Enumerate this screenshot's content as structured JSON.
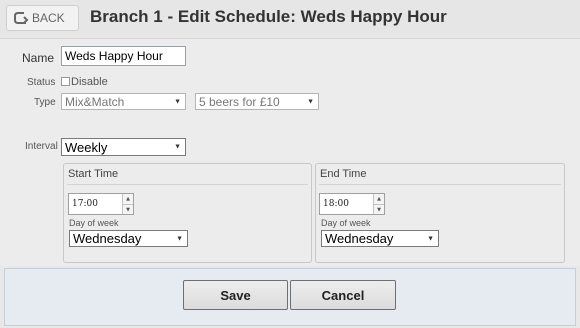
{
  "header": {
    "back_label": "BACK",
    "title": "Branch 1 - Edit Schedule: Weds Happy Hour"
  },
  "form": {
    "name_label": "Name",
    "name_value": "Weds Happy Hour",
    "status_label": "Status",
    "disable_label": "Disable",
    "disable_checked": false,
    "type_label": "Type",
    "type_value": "Mix&Match",
    "promo_value": "5 beers for £10",
    "interval_label": "Interval",
    "interval_value": "Weekly"
  },
  "start_time": {
    "title": "Start Time",
    "time_value": "17:00",
    "day_label": "Day of week",
    "day_value": "Wednesday"
  },
  "end_time": {
    "title": "End Time",
    "time_value": "18:00",
    "day_label": "Day of week",
    "day_value": "Wednesday"
  },
  "footer": {
    "save_label": "Save",
    "cancel_label": "Cancel"
  },
  "icons": {
    "back": "back-arrow-icon",
    "dropdown": "caret-down-icon",
    "spinner": "spinner-arrows-icon"
  }
}
